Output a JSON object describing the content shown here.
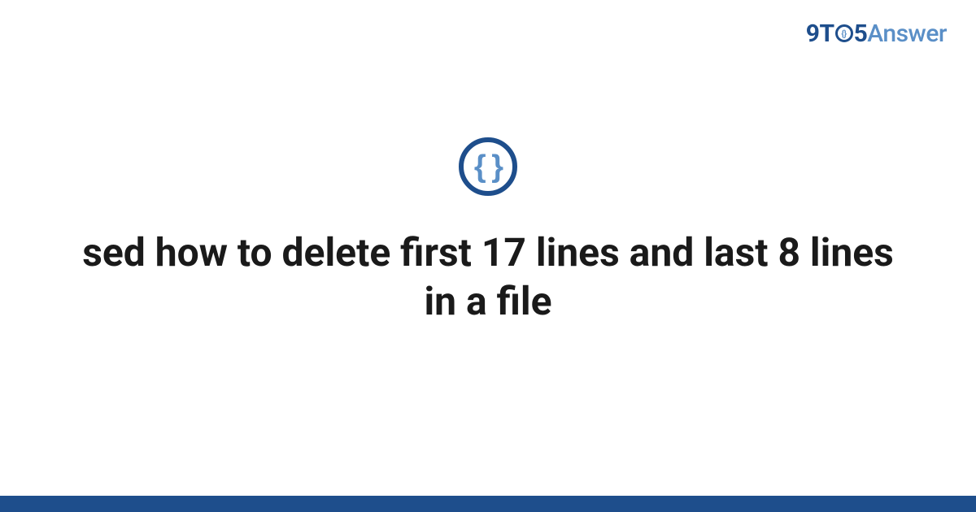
{
  "brand": {
    "nine": "9",
    "t": "T",
    "o_inner": "{}",
    "five": "5",
    "answer": "Answer"
  },
  "icon": {
    "braces": "{ }"
  },
  "title": "sed how to delete first 17 lines and last 8 lines in a file",
  "colors": {
    "brand_dark": "#1e4e8c",
    "brand_light": "#5a8fc7",
    "text": "#1a1a1a",
    "bg": "#ffffff"
  }
}
